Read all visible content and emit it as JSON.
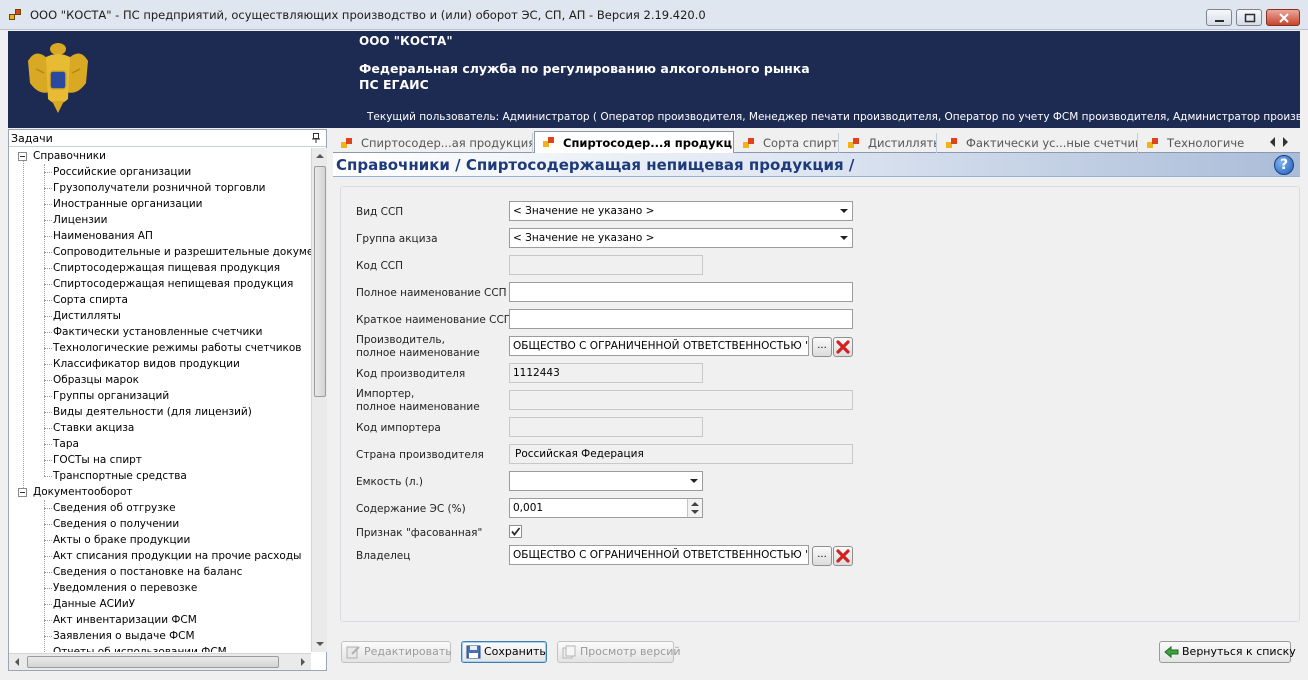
{
  "window": {
    "title": "ООО \"КОСТА\" - ПС предприятий, осуществляющих производство и (или) оборот ЭС, СП, АП - Версия 2.19.420.0"
  },
  "banner": {
    "org": "ООО \"КОСТА\"",
    "service": "Федеральная служба по регулированию алкогольного рынка",
    "system": "ПС ЕГАИС",
    "user": "Текущий пользователь: Администратор ( Оператор производителя, Менеджер печати производителя, Оператор по учету ФСМ производителя, Администратор производителя, Опе..."
  },
  "tasks": {
    "title": "Задачи",
    "groups": [
      {
        "label": "Справочники",
        "items": [
          "Российские организации",
          "Грузополучатели розничной торговли",
          "Иностранные организации",
          "Лицензии",
          "Наименования АП",
          "Сопроводительные и разрешительные документы",
          "Спиртосодержащая пищевая продукция",
          "Спиртосодержащая непищевая продукция",
          "Сорта спирта",
          "Дистилляты",
          "Фактически установленные счетчики",
          "Технологические режимы работы счетчиков",
          "Классификатор видов продукции",
          "Образцы марок",
          "Группы организаций",
          "Виды деятельности (для лицензий)",
          "Ставки акциза",
          "Тара",
          "ГОСТы на спирт",
          "Транспортные средства"
        ]
      },
      {
        "label": "Документооборот",
        "items": [
          "Сведения об отгрузке",
          "Сведения о получении",
          "Акты о браке продукции",
          "Акт списания продукции на прочие расходы",
          "Сведения о постановке на баланс",
          "Уведомления о перевозке",
          "Данные АСИиУ",
          "Акт инвентаризации ФСМ",
          "Заявления о выдаче ФСМ",
          "Отчеты об использовании ФСМ"
        ]
      }
    ]
  },
  "tabs": [
    {
      "label": "Спиртосодер...ая продукция",
      "active": false
    },
    {
      "label": "Спиртосодер...я продукция",
      "active": true
    },
    {
      "label": "Сорта спирта",
      "active": false
    },
    {
      "label": "Дистилляты",
      "active": false
    },
    {
      "label": "Фактически ус...ные счетчики",
      "active": false
    },
    {
      "label": "Технологиче",
      "active": false
    }
  ],
  "page": {
    "breadcrumb": "Справочники / Спиртосодержащая непищевая продукция /",
    "help": "?"
  },
  "form": {
    "vid_label": "Вид ССП",
    "vid_value": "< Значение не указано >",
    "gruppa_label": "Группа акциза",
    "gruppa_value": "< Значение не указано >",
    "kod_label": "Код ССП",
    "kod_value": "",
    "full_name_label": "Полное наименование ССП",
    "full_name_value": "",
    "short_name_label": "Краткое наименование ССП",
    "short_name_value": "",
    "producer_label_1": "Производитель,",
    "producer_label_2": "полное наименование",
    "producer_value": "ОБЩЕСТВО С ОГРАНИЧЕННОЙ ОТВЕТСТВЕННОСТЬЮ \"КОСТА\"",
    "producer_code_label": "Код производителя",
    "producer_code_value": "1112443",
    "importer_label_1": "Импортер,",
    "importer_label_2": "полное наименование",
    "importer_value": "",
    "importer_code_label": "Код импортера",
    "importer_code_value": "",
    "country_label": "Страна производителя",
    "country_value": "Российская Федерация",
    "capacity_label": "Емкость (л.)",
    "capacity_value": "",
    "content_label": "Содержание ЭС (%)",
    "content_value": "0,001",
    "packed_label": "Признак \"фасованная\"",
    "packed_checked": true,
    "owner_label": "Владелец",
    "owner_value": "ОБЩЕСТВО С ОГРАНИЧЕННОЙ ОТВЕТСТВЕННОСТЬЮ \"КОСТА\"",
    "browse_label": "..."
  },
  "buttons": {
    "edit": "Редактировать",
    "save": "Сохранить",
    "versions": "Просмотр версий",
    "back": "Вернуться к списку"
  },
  "colors": {
    "banner": "#1d2a52",
    "breadcrumb": "#1e3a7a",
    "delete": "#d32020"
  }
}
